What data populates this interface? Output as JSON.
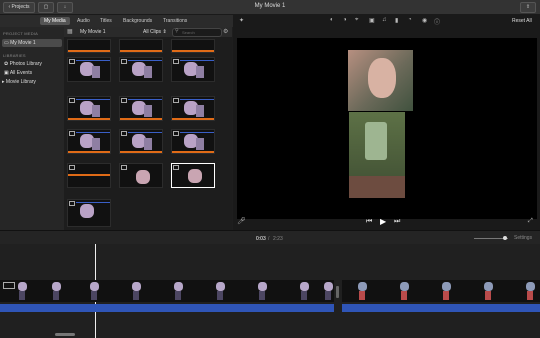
{
  "titlebar": {
    "projects_label": "Projects",
    "window_title": "My Movie 1"
  },
  "toolbar": {
    "tabs": [
      "My Media",
      "Audio",
      "Titles",
      "Backgrounds",
      "Transitions"
    ],
    "active_tab": "My Media"
  },
  "sidebar": {
    "project_media_header": "PROJECT MEDIA",
    "project_item": "My Movie 1",
    "libraries_header": "LIBRARIES",
    "library_items": [
      "Photos Library",
      "All Events"
    ],
    "movie_library": "Movie Library"
  },
  "browser": {
    "title": "My Movie 1",
    "filter": "All Clips",
    "search_placeholder": "Search"
  },
  "viewer": {
    "reset_all": "Reset All"
  },
  "timeline": {
    "current_time": "0:03",
    "separator": "/",
    "total_time": "2:23",
    "settings_label": "Settings"
  },
  "colors": {
    "accent_orange": "#e06b17",
    "audio_blue": "#2f55b7",
    "selection_white": "#ffffff"
  },
  "icons": [
    "magic-wand-icon",
    "color-balance-icon",
    "color-correction-icon",
    "crop-icon",
    "stabilization-icon",
    "volume-icon",
    "equalizer-icon",
    "speed-icon",
    "noise-reduction-icon",
    "info-icon",
    "microphone-icon",
    "skip-back-icon",
    "play-icon",
    "skip-forward-icon",
    "fullscreen-icon",
    "grid-view-icon",
    "settings-icon"
  ]
}
